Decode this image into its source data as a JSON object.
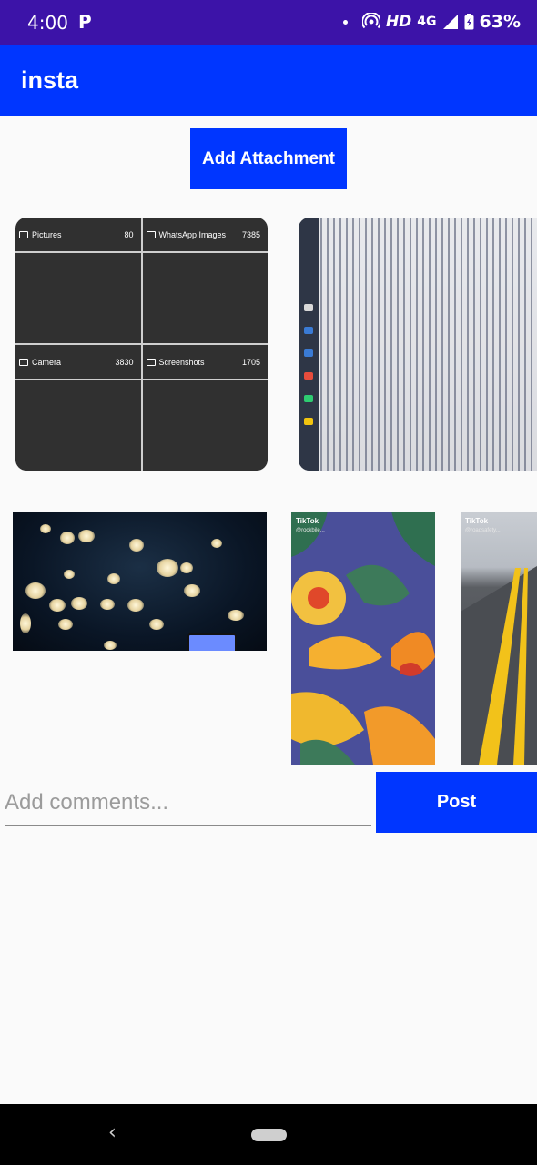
{
  "status_bar": {
    "time": "4:00",
    "app_icon": "P",
    "hd_label": "HD",
    "network_label": "4G",
    "battery_pct": "63%"
  },
  "app_bar": {
    "title": "insta"
  },
  "attach_button_label": "Add Attachment",
  "gallery": {
    "folders": [
      {
        "name": "Pictures",
        "count": "80"
      },
      {
        "name": "WhatsApp Images",
        "count": "7385"
      },
      {
        "name": "Camera",
        "count": "3830"
      },
      {
        "name": "Screenshots",
        "count": "1705"
      }
    ],
    "tiktok_label": "TikTok",
    "carpet_handle": "@rockbile...",
    "road_handle": "@roadsafety..."
  },
  "comment": {
    "placeholder": "Add comments...",
    "value": ""
  },
  "post_button_label": "Post",
  "colors": {
    "status_bar": "#3c13a8",
    "app_bar": "#0036ff",
    "button": "#0036ff",
    "background": "#fafafa"
  },
  "icons": {
    "back": "back-icon",
    "home": "home-pill-icon",
    "folder": "folder-icon"
  }
}
